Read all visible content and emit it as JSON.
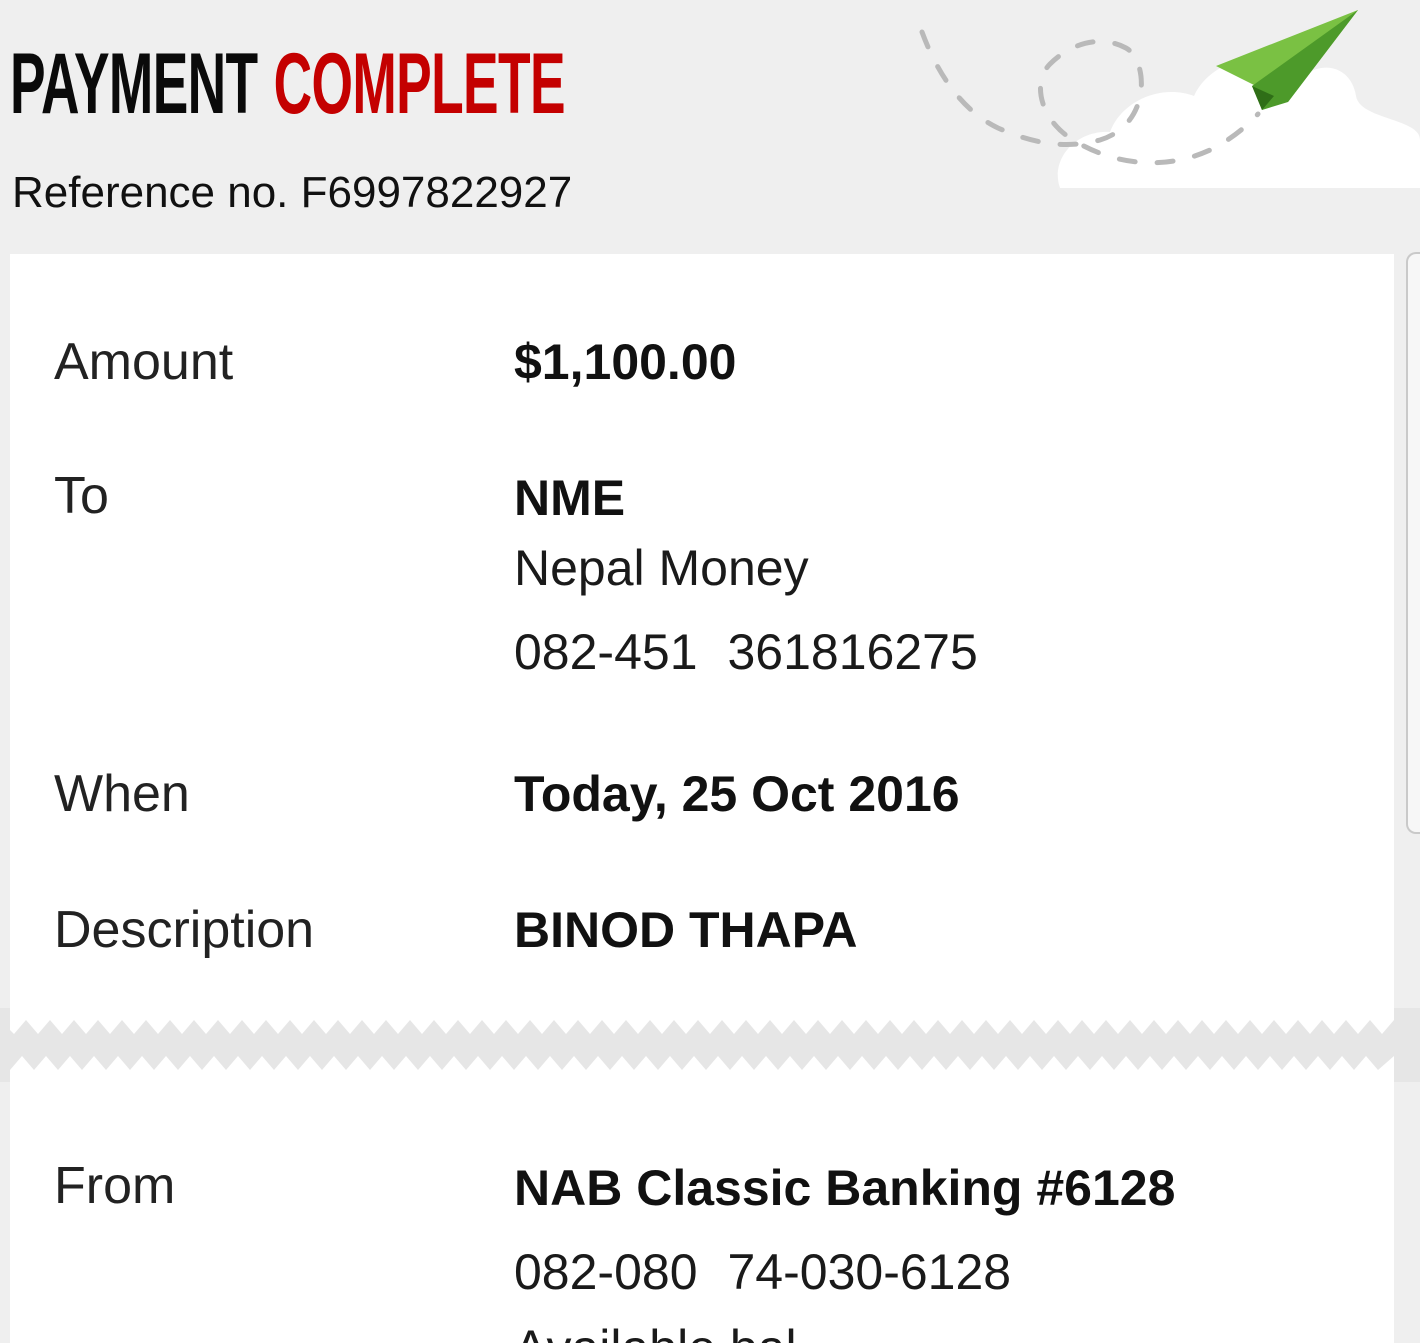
{
  "header": {
    "title_word1": "PAYMENT",
    "title_word2": "COMPLETE",
    "reference": "Reference no. F6997822927"
  },
  "colors": {
    "title_dark": "#0a0a0a",
    "title_accent": "#c40000",
    "plane": "#6cc04a",
    "background": "#efefef",
    "card": "#ffffff"
  },
  "details": {
    "amount_label": "Amount",
    "amount_value": "$1,100.00",
    "to_label": "To",
    "to_code": "NME",
    "to_name": "Nepal Money",
    "to_bsb": "082-451",
    "to_account": "361816275",
    "when_label": "When",
    "when_value": "Today, 25 Oct 2016",
    "description_label": "Description",
    "description_value": "BINOD THAPA"
  },
  "from": {
    "label": "From",
    "account_name": "NAB Classic Banking #6128",
    "bsb": "082-080",
    "account": "74-030-6128",
    "partial_text": "Available bal"
  },
  "icons": {
    "illustration": "paper-plane-icon",
    "cloud": "cloud-icon"
  }
}
